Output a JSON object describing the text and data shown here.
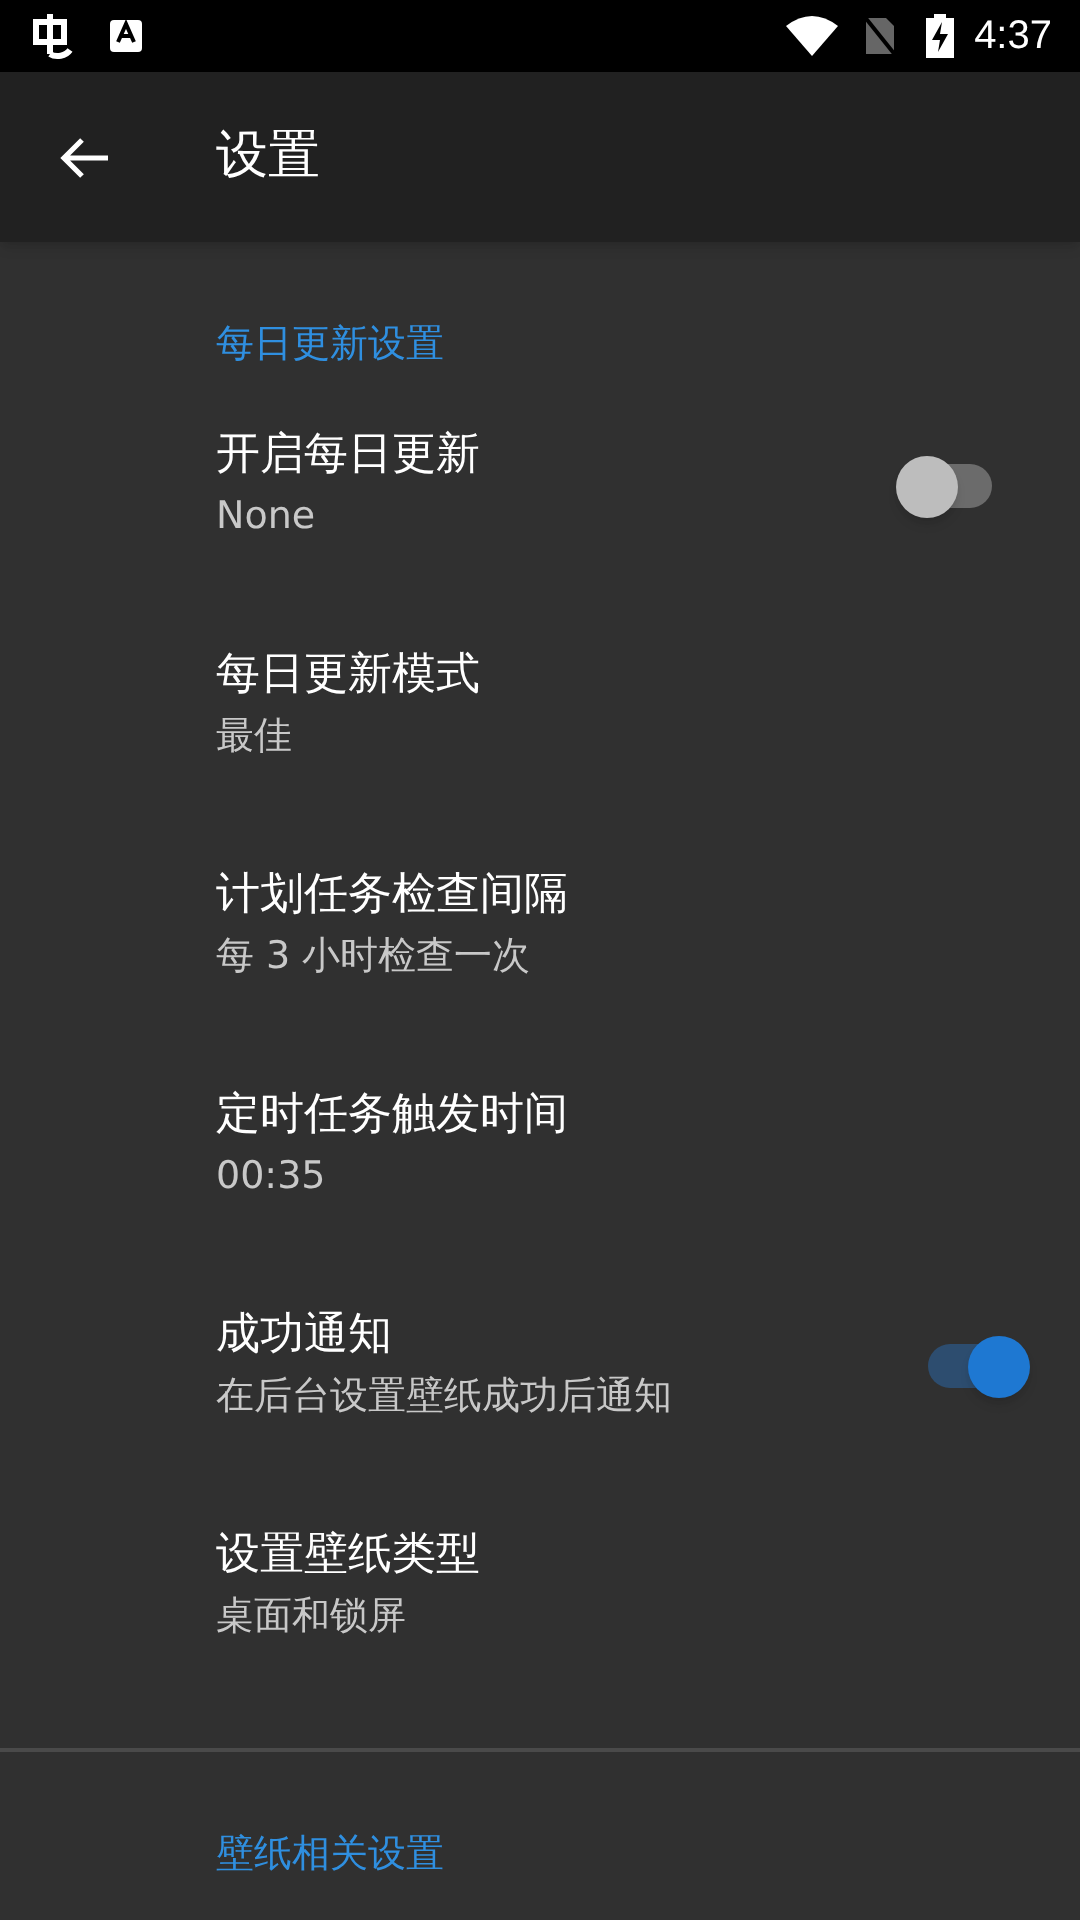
{
  "status_bar": {
    "time": "4:37"
  },
  "app_bar": {
    "title": "设置"
  },
  "sections": [
    {
      "header": "每日更新设置",
      "items": [
        {
          "kind": "switch",
          "title": "开启每日更新",
          "summary": "None",
          "on": false
        },
        {
          "kind": "plain",
          "title": "每日更新模式",
          "summary": "最佳"
        },
        {
          "kind": "plain",
          "title": "计划任务检查间隔",
          "summary": "每 3 小时检查一次"
        },
        {
          "kind": "plain",
          "title": "定时任务触发时间",
          "summary": "00:35"
        },
        {
          "kind": "switch",
          "title": "成功通知",
          "summary": "在后台设置壁纸成功后通知",
          "on": true
        },
        {
          "kind": "plain",
          "title": "设置壁纸类型",
          "summary": "桌面和锁屏"
        }
      ]
    },
    {
      "header": "壁纸相关设置"
    }
  ]
}
